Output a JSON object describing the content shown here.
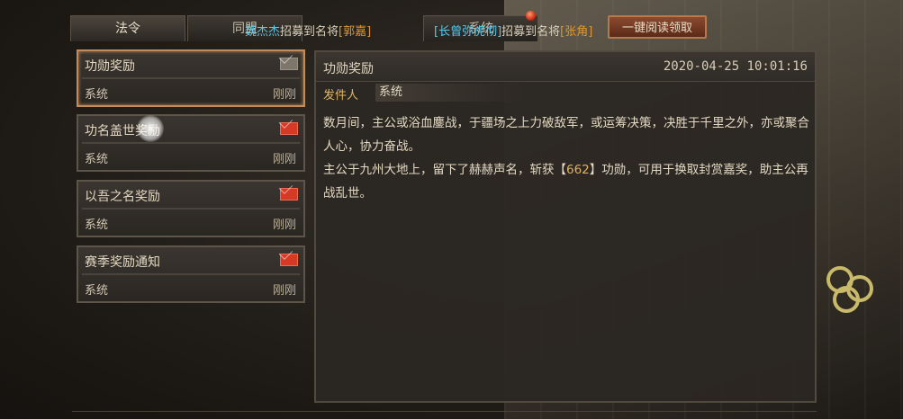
{
  "tabs": {
    "decree": "法令",
    "alliance": "同盟",
    "system": "系统"
  },
  "news": {
    "item1_name": "魏杰杰",
    "item1_text": "招募到名将",
    "item1_general": "[郭嘉]",
    "item2_name": "[长曾弥虎彻]",
    "item2_text": "招募到名将",
    "item2_general": "[张角]"
  },
  "read_all_button": "一键阅读领取",
  "mails": [
    {
      "title": "功勋奖励",
      "sender": "系统",
      "time": "刚刚",
      "read": true
    },
    {
      "title": "功名盖世奖励",
      "sender": "系统",
      "time": "刚刚",
      "read": false
    },
    {
      "title": "以吾之名奖励",
      "sender": "系统",
      "time": "刚刚",
      "read": false
    },
    {
      "title": "赛季奖励通知",
      "sender": "系统",
      "time": "刚刚",
      "read": false
    }
  ],
  "detail": {
    "title": "功勋奖励",
    "date": "2020-04-25 10:01:16",
    "sender_label": "发件人",
    "sender": "系统",
    "body_line1": "数月间，主公或浴血鏖战，于疆场之上力破敌军，或运筹决策，决胜于千里之外，亦或聚合人心，协力奋战。",
    "body_line2_pre": "主公于九州大地上，留下了赫赫声名，斩获【",
    "body_reward": "662",
    "body_line2_post": "】功勋，可用于换取封赏嘉奖，助主公再战乱世。"
  },
  "colors": {
    "accent_orange": "#e0962e",
    "accent_blue": "#5ec8e8",
    "unread_envelope": "#d63a26",
    "selected_border": "#c48a58"
  }
}
